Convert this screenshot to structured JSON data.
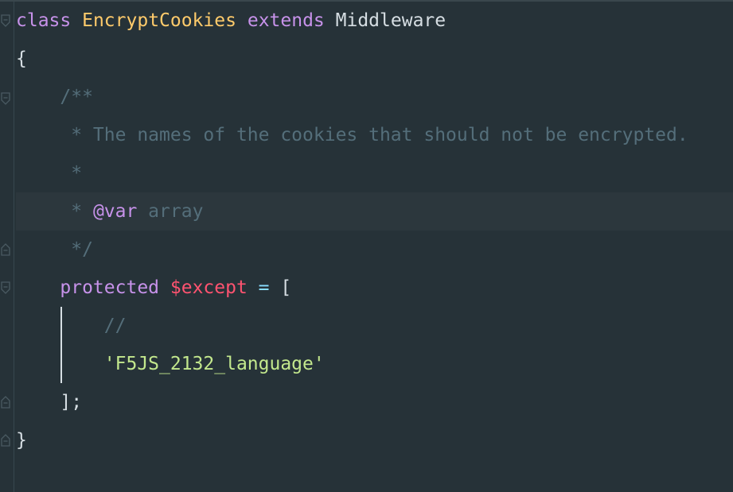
{
  "editor": {
    "lines": [
      {
        "tokens": [
          {
            "t": "class",
            "c": "kw"
          },
          {
            "t": " ",
            "c": "plain"
          },
          {
            "t": "EncryptCookies",
            "c": "cls"
          },
          {
            "t": " ",
            "c": "plain"
          },
          {
            "t": "extends",
            "c": "kw"
          },
          {
            "t": " ",
            "c": "plain"
          },
          {
            "t": "Middleware",
            "c": "plain"
          }
        ]
      },
      {
        "tokens": [
          {
            "t": "{",
            "c": "plain"
          }
        ]
      },
      {
        "tokens": [
          {
            "t": "    /**",
            "c": "cm"
          }
        ]
      },
      {
        "tokens": [
          {
            "t": "     * The names of the cookies that should not be encrypted.",
            "c": "cm"
          }
        ]
      },
      {
        "tokens": [
          {
            "t": "     *",
            "c": "cm"
          }
        ]
      },
      {
        "tokens": [
          {
            "t": "     * ",
            "c": "cm"
          },
          {
            "t": "@var",
            "c": "doctag"
          },
          {
            "t": " array",
            "c": "cm"
          }
        ]
      },
      {
        "tokens": [
          {
            "t": "     */",
            "c": "cm"
          }
        ]
      },
      {
        "tokens": [
          {
            "t": "    ",
            "c": "plain"
          },
          {
            "t": "protected",
            "c": "kw"
          },
          {
            "t": " ",
            "c": "plain"
          },
          {
            "t": "$except",
            "c": "var"
          },
          {
            "t": " ",
            "c": "plain"
          },
          {
            "t": "=",
            "c": "op"
          },
          {
            "t": " [",
            "c": "plain"
          }
        ]
      },
      {
        "tokens": [
          {
            "t": "        //",
            "c": "cm"
          }
        ]
      },
      {
        "tokens": [
          {
            "t": "        ",
            "c": "plain"
          },
          {
            "t": "'F5JS_2132_language'",
            "c": "str"
          }
        ]
      },
      {
        "tokens": [
          {
            "t": "    ];",
            "c": "plain"
          }
        ]
      },
      {
        "tokens": [
          {
            "t": "}",
            "c": "plain"
          }
        ]
      }
    ],
    "current_line": 5
  }
}
